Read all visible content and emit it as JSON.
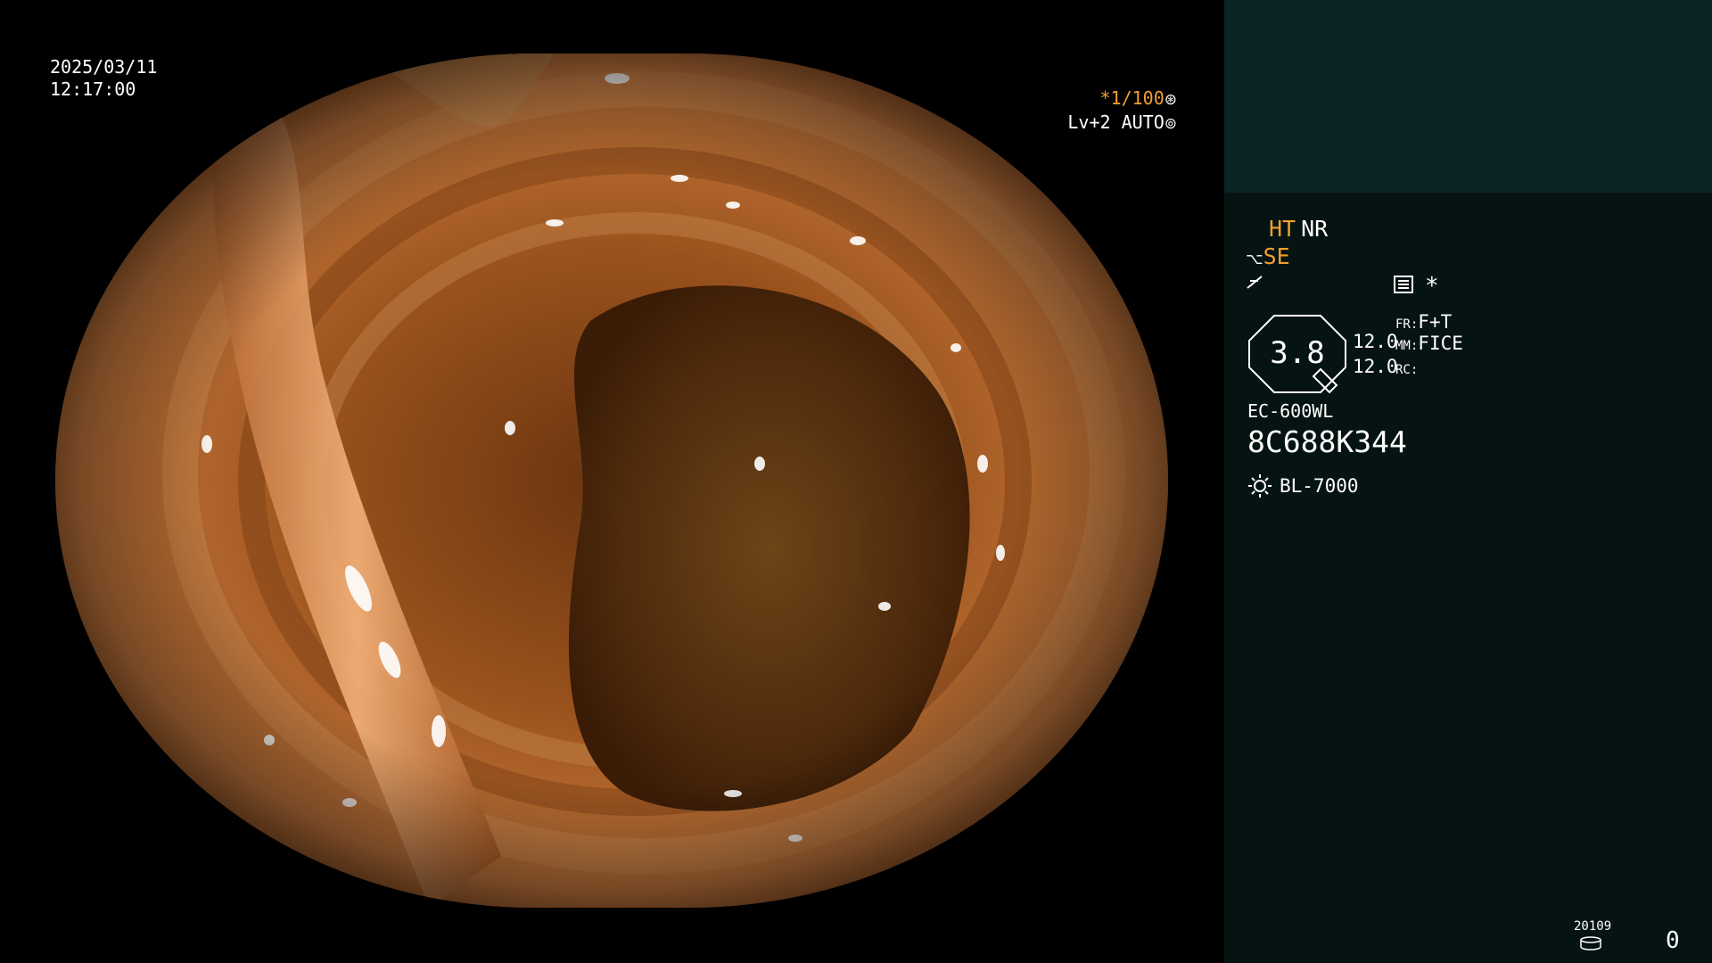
{
  "image": {
    "date": "2025/03/11",
    "time": "12:17:00",
    "shutter_speed": "*1/100",
    "shutter_icon": "aperture-icon",
    "exposure_level": "Lv+2 AUTO",
    "exposure_icon": "iris-icon"
  },
  "panel": {
    "mode_ht": "HT",
    "mode_nr": "NR",
    "se": "SE",
    "value": "3.8",
    "num_1": "12.0",
    "num_2": "12.0",
    "fr_label": "FR:",
    "fr_value": "F+T",
    "mm_label": "MM:",
    "mm_value": "FICE",
    "rc_label": "RC:",
    "rc_value": "",
    "asterisk": "*",
    "scope_model": "EC-600WL",
    "scope_serial": "8C688K344",
    "light_source": "BL-7000",
    "counter_small": "20109",
    "counter_big": "0"
  },
  "colors": {
    "accent_orange": "#f0a030",
    "panel_top": "#0a2325",
    "panel_bg": "#051312"
  }
}
